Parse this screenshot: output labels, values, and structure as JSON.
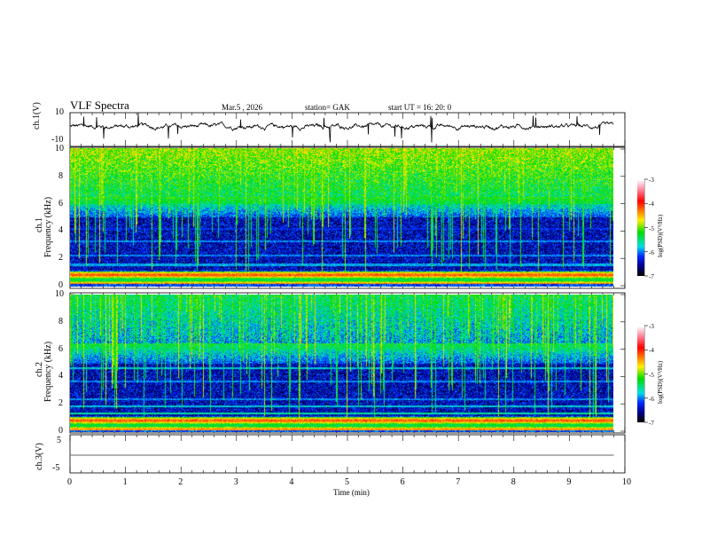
{
  "header": {
    "title": "VLF  Spectra",
    "date": "Mar.5  , 2026",
    "station": "station= GAK",
    "start": "start  UT  =    16: 20: 0"
  },
  "chart_data": [
    {
      "type": "line",
      "panel": "ch1 waveform",
      "ylabel": "ch.1(V)",
      "ylim": [
        -10,
        10
      ],
      "yticks": [
        "10",
        "-10"
      ],
      "xlim": [
        0,
        10
      ],
      "data_end_min": 9.8,
      "color": "#000000"
    },
    {
      "type": "heatmap",
      "panel": "ch1 spectrogram",
      "ylabel": "ch.1\nFrequency  (kHz)",
      "ylabel_top": "ch.1",
      "ylabel_bottom": "Frequency  (kHz)",
      "ylim": [
        0,
        10
      ],
      "yticks": [
        "0",
        "2",
        "4",
        "6",
        "8",
        "10"
      ],
      "xlim": [
        0,
        10
      ],
      "colorbar": {
        "label": "log(PSD)(V²/Hz)",
        "range": [
          -7,
          -3
        ],
        "ticks": [
          "-3",
          "-4",
          "-5",
          "-6",
          "-7"
        ]
      }
    },
    {
      "type": "heatmap",
      "panel": "ch2 spectrogram",
      "ylabel_top": "ch.2",
      "ylabel_bottom": "Frequency  (kHz)",
      "ylim": [
        0,
        10
      ],
      "yticks": [
        "0",
        "2",
        "4",
        "6",
        "8",
        "10"
      ],
      "xlim": [
        0,
        10
      ],
      "colorbar": {
        "label": "log(PSD)(V²/Hz)",
        "range": [
          -7,
          -3
        ],
        "ticks": [
          "-3",
          "-4",
          "-5",
          "-6",
          "-7"
        ]
      }
    },
    {
      "type": "line",
      "panel": "ch3 waveform",
      "ylabel": "ch.3(V)",
      "ylim": [
        -5,
        5
      ],
      "yticks": [
        "5",
        "-5"
      ],
      "xlim": [
        0,
        10
      ],
      "constant_value": -0.5,
      "color": "#666666"
    }
  ],
  "xaxis": {
    "label": "Time  (min)",
    "ticks": [
      "0",
      "1",
      "2",
      "3",
      "4",
      "5",
      "6",
      "7",
      "8",
      "9",
      "10"
    ]
  }
}
